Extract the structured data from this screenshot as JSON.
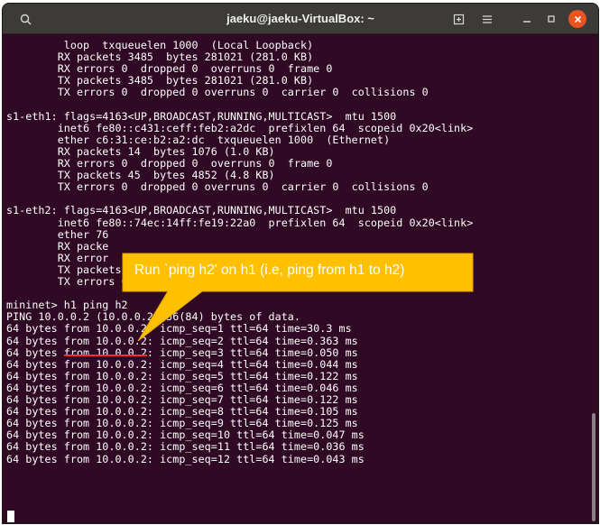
{
  "window": {
    "title": "jaeku@jaeku-VirtualBox: ~",
    "icons": {
      "search": "search-icon",
      "new_tab": "new-tab-icon",
      "menu": "hamburger-menu-icon",
      "minimize": "minimize-icon",
      "maximize": "maximize-icon",
      "close": "close-icon"
    },
    "accent_close": "#e95420"
  },
  "terminal": {
    "background": "#300a24",
    "foreground": "#ffffff",
    "lines": [
      "         loop  txqueuelen 1000  (Local Loopback)",
      "        RX packets 3485  bytes 281021 (281.0 KB)",
      "        RX errors 0  dropped 0  overruns 0  frame 0",
      "        TX packets 3485  bytes 281021 (281.0 KB)",
      "        TX errors 0  dropped 0 overruns 0  carrier 0  collisions 0",
      "",
      "s1-eth1: flags=4163<UP,BROADCAST,RUNNING,MULTICAST>  mtu 1500",
      "        inet6 fe80::c431:ceff:feb2:a2dc  prefixlen 64  scopeid 0x20<link>",
      "        ether c6:31:ce:b2:a2:dc  txqueuelen 1000  (Ethernet)",
      "        RX packets 14  bytes 1076 (1.0 KB)",
      "        RX errors 0  dropped 0  overruns 0  frame 0",
      "        TX packets 45  bytes 4852 (4.8 KB)",
      "        TX errors 0  dropped 0 overruns 0  carrier 0  collisions 0",
      "",
      "s1-eth2: flags=4163<UP,BROADCAST,RUNNING,MULTICAST>  mtu 1500",
      "        inet6 fe80::74ec:14ff:fe19:22a0  prefixlen 64  scopeid 0x20<link>",
      "        ether 76",
      "        RX packe",
      "        RX error",
      "        TX packets 46  b          .9 KB)",
      "        TX errors 0  d        overruns 0  carrier 0  collisions 0",
      "",
      "mininet> h1 ping h2",
      "PING 10.0.0.2 (10.0.0.2) 56(84) bytes of data.",
      "64 bytes from 10.0.0.2: icmp_seq=1 ttl=64 time=30.3 ms",
      "64 bytes from 10.0.0.2: icmp_seq=2 ttl=64 time=0.363 ms",
      "64 bytes from 10.0.0.2: icmp_seq=3 ttl=64 time=0.050 ms",
      "64 bytes from 10.0.0.2: icmp_seq=4 ttl=64 time=0.044 ms",
      "64 bytes from 10.0.0.2: icmp_seq=5 ttl=64 time=0.122 ms",
      "64 bytes from 10.0.0.2: icmp_seq=6 ttl=64 time=0.046 ms",
      "64 bytes from 10.0.0.2: icmp_seq=7 ttl=64 time=0.122 ms",
      "64 bytes from 10.0.0.2: icmp_seq=8 ttl=64 time=0.105 ms",
      "64 bytes from 10.0.0.2: icmp_seq=9 ttl=64 time=0.125 ms",
      "64 bytes from 10.0.0.2: icmp_seq=10 ttl=64 time=0.047 ms",
      "64 bytes from 10.0.0.2: icmp_seq=11 ttl=64 time=0.036 ms",
      "64 bytes from 10.0.0.2: icmp_seq=12 ttl=64 time=0.043 ms"
    ]
  },
  "annotation": {
    "callout_text": "Run `ping h2' on h1 (i.e, ping from h1 to h2)",
    "callout_color": "#ffc000",
    "underline_color": "#ff2a2a"
  }
}
